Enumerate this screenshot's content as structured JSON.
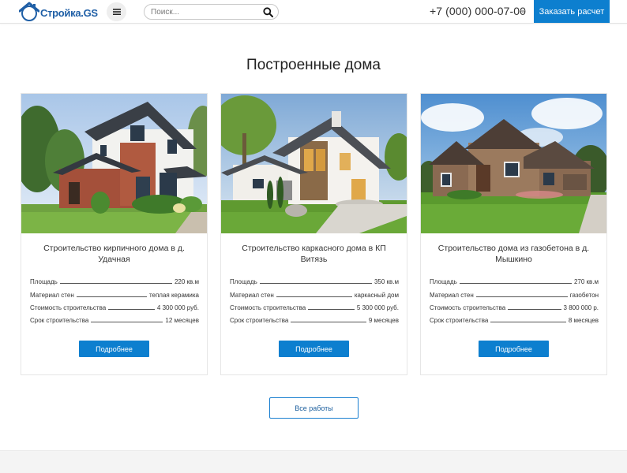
{
  "header": {
    "logo_text": "Стройка.GS",
    "search_placeholder": "Поиск...",
    "phone": "+7 (000) 000-07-00",
    "order_button": "Заказать расчет"
  },
  "section": {
    "title": "Построенные дома"
  },
  "cards": [
    {
      "title": "Строительство кирпичного дома в д. Удачная",
      "specs": [
        {
          "label": "Площадь",
          "value": "220 кв.м"
        },
        {
          "label": "Материал стен",
          "value": "теплая керамика"
        },
        {
          "label": "Стоимость строительства",
          "value": "4 300 000 руб."
        },
        {
          "label": "Срок строительства",
          "value": "12 месяцев"
        }
      ],
      "button": "Подробнее"
    },
    {
      "title": "Строительство каркасного дома в КП Витязь",
      "specs": [
        {
          "label": "Площадь",
          "value": "350 кв.м"
        },
        {
          "label": "Материал стен",
          "value": "каркасный дом"
        },
        {
          "label": "Стоимость строительства",
          "value": "5 300 000 руб."
        },
        {
          "label": "Срок строительства",
          "value": "9 месяцев"
        }
      ],
      "button": "Подробнее"
    },
    {
      "title": "Строительство дома из газобетона в д. Мышкино",
      "specs": [
        {
          "label": "Площадь",
          "value": "270 кв.м"
        },
        {
          "label": "Материал стен",
          "value": "газобетон"
        },
        {
          "label": "Стоимость строительства",
          "value": "3 800 000 р."
        },
        {
          "label": "Срок строительства",
          "value": "8 месяцев"
        }
      ],
      "button": "Подробнее"
    }
  ],
  "all_works_button": "Все работы",
  "colors": {
    "accent": "#0d7fcf",
    "logo": "#1f5fa6"
  },
  "icons": {
    "logo": "house-logo-icon",
    "menu": "hamburger-menu-icon",
    "search": "search-icon",
    "phone_dropdown": "caret-down-icon"
  }
}
